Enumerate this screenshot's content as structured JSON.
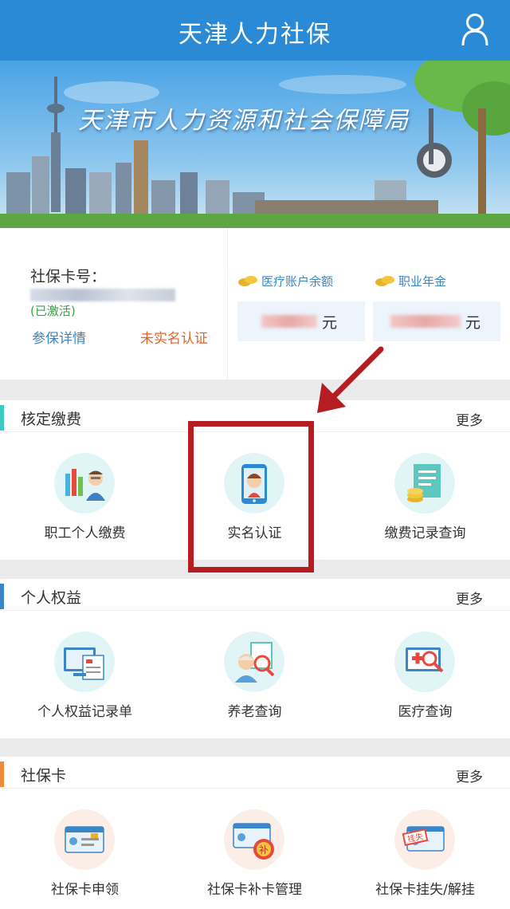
{
  "header": {
    "title": "天津人力社保",
    "user_icon": "user-icon"
  },
  "banner": {
    "text": "天津市人力资源和社会保障局"
  },
  "account": {
    "card_label": "社保卡号：",
    "status": "(已激活)",
    "detail_link": "参保详情",
    "verify_status": "未实名认证",
    "medical_label": "医疗账户余额",
    "medical_unit": "元",
    "annuity_label": "职业年金",
    "annuity_unit": "元"
  },
  "sections": [
    {
      "name": "核定缴费",
      "more": "更多",
      "accent": "#3ec9c2",
      "items": [
        {
          "label": "职工个人缴费",
          "icon": "employee-payment-icon"
        },
        {
          "label": "实名认证",
          "icon": "real-name-verify-icon"
        },
        {
          "label": "缴费记录查询",
          "icon": "payment-record-icon"
        }
      ]
    },
    {
      "name": "个人权益",
      "more": "更多",
      "accent": "#3a86c8",
      "items": [
        {
          "label": "个人权益记录单",
          "icon": "rights-record-icon"
        },
        {
          "label": "养老查询",
          "icon": "pension-query-icon"
        },
        {
          "label": "医疗查询",
          "icon": "medical-query-icon"
        }
      ]
    },
    {
      "name": "社保卡",
      "more": "更多",
      "accent": "#f08a3a",
      "items": [
        {
          "label": "社保卡申领",
          "icon": "card-apply-icon"
        },
        {
          "label": "社保卡补卡管理",
          "icon": "card-reissue-icon"
        },
        {
          "label": "社保卡挂失/解挂",
          "icon": "card-report-loss-icon"
        }
      ]
    }
  ],
  "colors": {
    "header": "#2a8ad6",
    "highlight": "#b51d22",
    "link": "#3a86c8",
    "warning": "#e0652a"
  }
}
